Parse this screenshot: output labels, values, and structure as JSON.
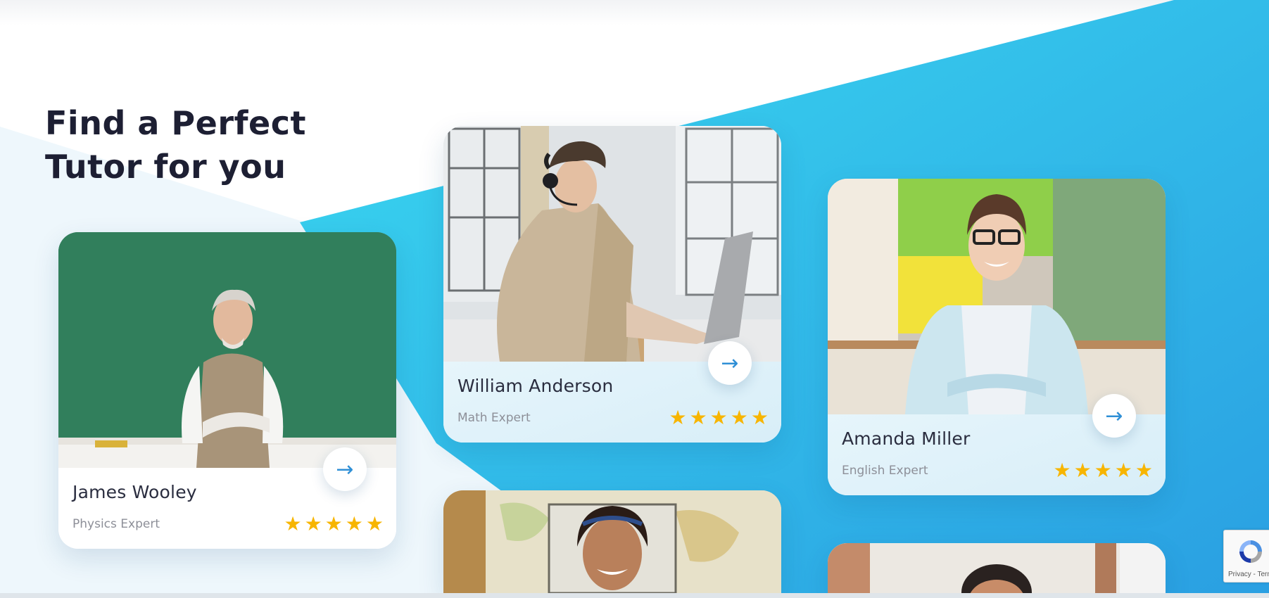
{
  "heading": {
    "line1": "Find a Perfect",
    "line2": "Tutor for you"
  },
  "colors": {
    "accent_blue": "#2ea4e3",
    "accent_cyan": "#3ad5ef",
    "star": "#f7b500",
    "arrow": "#2f8fd6"
  },
  "tutors": [
    {
      "name": "James Wooley",
      "subject": "Physics Expert",
      "rating": 5,
      "arrow": "→",
      "stars": [
        "★",
        "★",
        "★",
        "★",
        "★"
      ]
    },
    {
      "name": "William Anderson",
      "subject": "Math Expert",
      "rating": 5,
      "arrow": "→",
      "stars": [
        "★",
        "★",
        "★",
        "★",
        "★"
      ]
    },
    {
      "name": "Amanda Miller",
      "subject": "English Expert",
      "rating": 5,
      "arrow": "→",
      "stars": [
        "★",
        "★",
        "★",
        "★",
        "★"
      ]
    }
  ],
  "recaptcha": {
    "terms_text": "Privacy - Terms"
  },
  "icons": {
    "next": "arrow-right-icon",
    "rating": "star-icon",
    "captcha": "recaptcha-logo-icon"
  }
}
